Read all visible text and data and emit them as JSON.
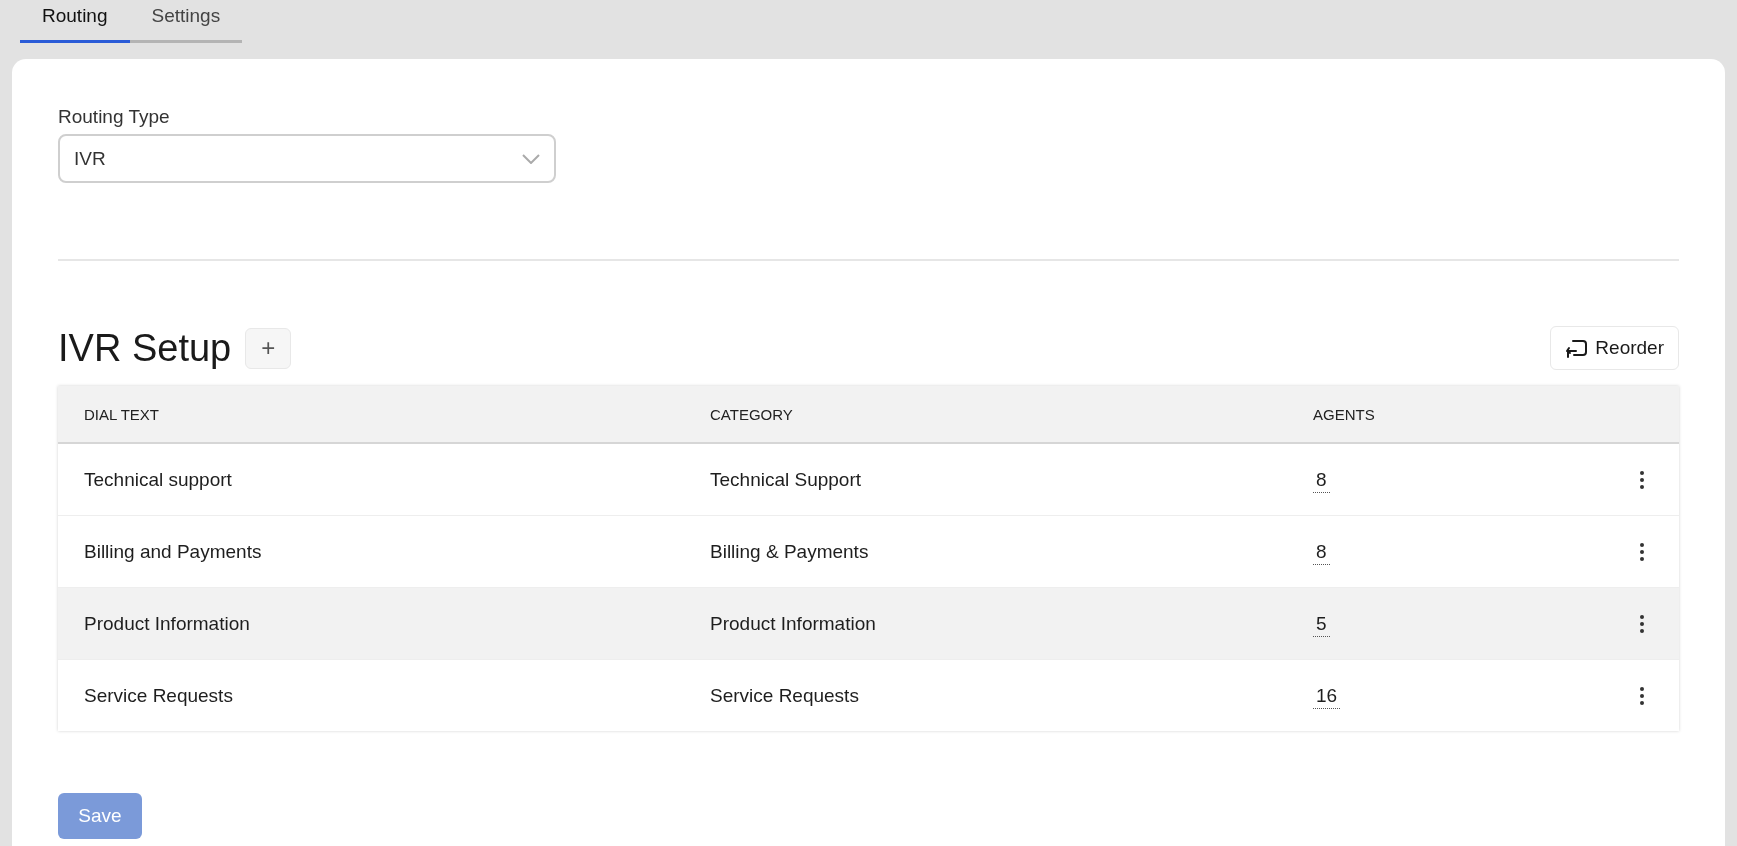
{
  "tabs": [
    {
      "label": "Routing",
      "selected": true
    },
    {
      "label": "Settings",
      "selected": false
    }
  ],
  "routing_type": {
    "label": "Routing Type",
    "value": "IVR"
  },
  "ivr_setup": {
    "title": "IVR Setup",
    "add_button": "+",
    "reorder_button": "Reorder",
    "table": {
      "columns": [
        "DIAL TEXT",
        "CATEGORY",
        "AGENTS"
      ],
      "rows": [
        {
          "dial_text": "Technical support",
          "category": "Technical Support",
          "agents": "8",
          "selected": false
        },
        {
          "dial_text": "Billing and Payments",
          "category": "Billing & Payments",
          "agents": "8",
          "selected": false
        },
        {
          "dial_text": "Product Information",
          "category": "Product Information",
          "agents": "5",
          "selected": true
        },
        {
          "dial_text": "Service Requests",
          "category": "Service Requests",
          "agents": "16",
          "selected": false
        }
      ]
    }
  },
  "save_button": {
    "label": "Save",
    "disabled": true
  }
}
